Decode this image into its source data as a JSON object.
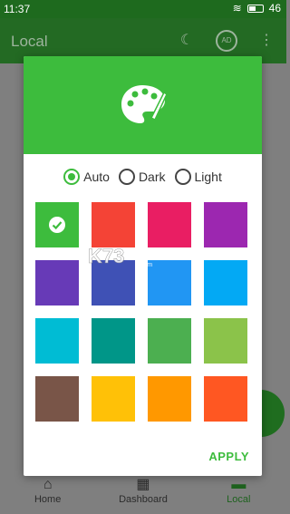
{
  "status": {
    "time": "11:37",
    "battery": "46"
  },
  "app_bar": {
    "title": "Local"
  },
  "dialog": {
    "modes": [
      {
        "label": "Auto",
        "selected": true
      },
      {
        "label": "Dark",
        "selected": false
      },
      {
        "label": "Light",
        "selected": false
      }
    ],
    "swatches": [
      "#3dbc3d",
      "#f44336",
      "#e91e63",
      "#9c27b0",
      "#673ab7",
      "#3f51b5",
      "#2196f3",
      "#03a9f4",
      "#00bcd4",
      "#009688",
      "#4caf50",
      "#8bc34a",
      "#795548",
      "#ffc107",
      "#ff9800",
      "#ff5722"
    ],
    "selected_swatch": 0,
    "apply_label": "APPLY"
  },
  "bottom_nav": [
    {
      "label": "Home",
      "icon": "home-icon",
      "active": false
    },
    {
      "label": "Dashboard",
      "icon": "dashboard-icon",
      "active": false
    },
    {
      "label": "Local",
      "icon": "folder-icon",
      "active": true
    }
  ],
  "watermark_text": "K73 游戏之家"
}
